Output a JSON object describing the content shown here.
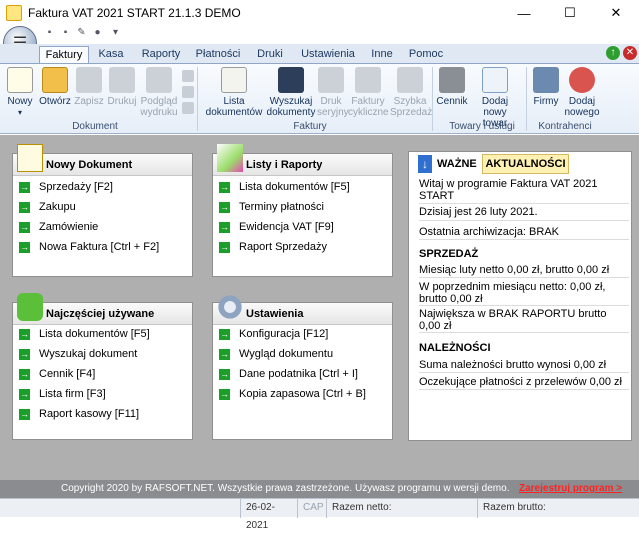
{
  "window": {
    "title": "Faktura VAT 2021 START 21.1.3 DEMO",
    "minimize": "—",
    "maximize": "☐",
    "close": "✕"
  },
  "tabs": [
    "Faktury",
    "Kasa",
    "Raporty",
    "Płatności",
    "Druki",
    "Ustawienia",
    "Inne",
    "Pomoc"
  ],
  "ribbon": {
    "nowy": "Nowy",
    "otworz": "Otwórz",
    "zapisz": "Zapisz",
    "drukuj": "Drukuj",
    "podglad": [
      "Podgląd",
      "wydruku"
    ],
    "group_dokument": "Dokument",
    "lista": [
      "Lista",
      "dokumentów"
    ],
    "wyszukaj": [
      "Wyszukaj",
      "dokumenty"
    ],
    "druk_seryjny": [
      "Druk",
      "seryjny"
    ],
    "faktury_cykliczne": [
      "Faktury",
      "cykliczne"
    ],
    "szybka": [
      "Szybka",
      "Sprzedaż"
    ],
    "group_faktury": "Faktury",
    "cennik": "Cennik",
    "dodaj_towar": [
      "Dodaj nowy",
      "towar"
    ],
    "group_towary": "Towary i usługi",
    "firmy": "Firmy",
    "dodaj_nowego": [
      "Dodaj",
      "nowego"
    ],
    "group_kontrahenci": "Kontrahenci"
  },
  "panels": {
    "nowy_dokument": {
      "title": "Nowy Dokument",
      "items": [
        "Sprzedaży [F2]",
        "Zakupu",
        "Zamówienie",
        "Nowa Faktura [Ctrl + F2]"
      ]
    },
    "listy_raporty": {
      "title": "Listy i Raporty",
      "items": [
        "Lista dokumentów [F5]",
        "Terminy płatności",
        "Ewidencja VAT [F9]",
        "Raport Sprzedaży"
      ]
    },
    "najczesciej": {
      "title": "Najczęściej używane",
      "items": [
        "Lista dokumentów [F5]",
        "Wyszukaj dokument",
        "Cennik [F4]",
        "Lista firm [F3]",
        "Raport kasowy [F11]"
      ]
    },
    "ustawienia": {
      "title": "Ustawienia",
      "items": [
        "Konfiguracja [F12]",
        "Wygląd dokumentu",
        "Dane podatnika [Ctrl + I]",
        "Kopia zapasowa [Ctrl + B]"
      ]
    }
  },
  "news": {
    "tab_wazne": "WAŻNE",
    "tab_aktualnosci": "AKTUALNOŚCI",
    "welcome": "Witaj w programie Faktura VAT 2021 START",
    "date": "Dzisiaj jest 26 luty 2021.",
    "archive": "Ostatnia archiwizacja: BRAK",
    "sprzedaz_head": "SPRZEDAŻ",
    "sprzedaz_lines": [
      "Miesiąc luty netto 0,00 zł, brutto 0,00 zł",
      "W poprzednim miesiącu netto: 0,00 zł, brutto 0,00 zł",
      "Największa w BRAK RAPORTU brutto 0,00 zł"
    ],
    "naleznosci_head": "NALEŻNOŚCI",
    "naleznosci_lines": [
      "Suma należności brutto wynosi 0,00 zł",
      "Oczekujące płatności z przelewów 0,00 zł"
    ]
  },
  "footer": {
    "text": "Copyright 2020 by RAFSOFT.NET. Wszystkie prawa zastrzeżone. Używasz programu w wersji demo.",
    "link": "Zarejestruj program >"
  },
  "status": {
    "date": "26-02-2021",
    "cap": "CAP",
    "netto": "Razem netto:",
    "brutto": "Razem brutto:"
  }
}
